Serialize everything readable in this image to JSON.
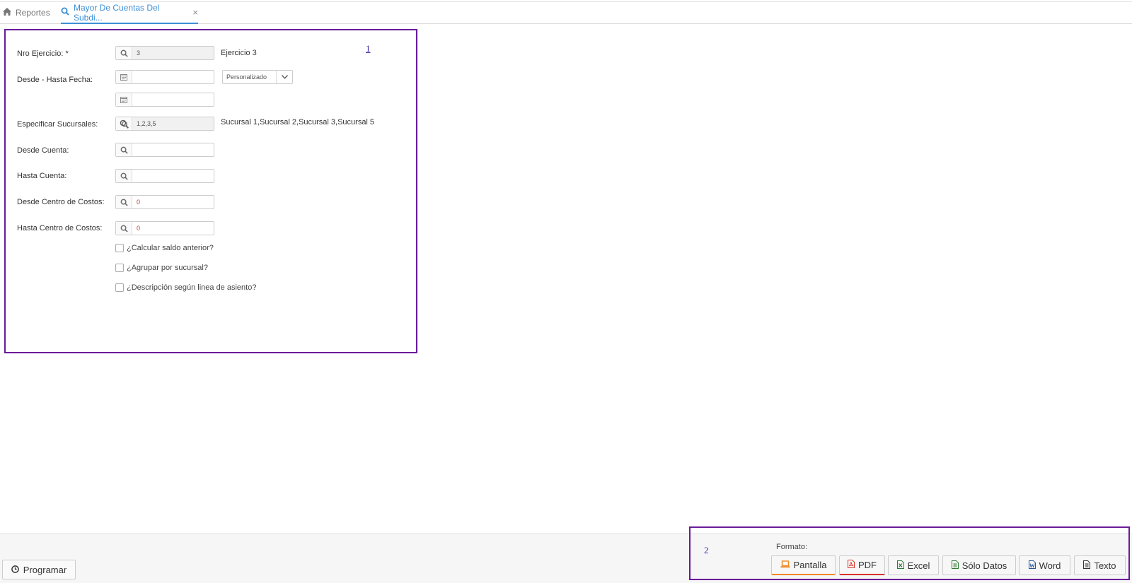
{
  "tabs": {
    "reportes_label": "Reportes",
    "active_label": "Mayor De Cuentas Del Subdi...",
    "close_glyph": "×"
  },
  "annotations": {
    "panel1": "1",
    "panel2": "2"
  },
  "form": {
    "nro_ejercicio": {
      "label": "Nro Ejercicio: *",
      "value": "3",
      "description": "Ejercicio 3"
    },
    "desde_hasta_fecha": {
      "label": "Desde - Hasta Fecha:",
      "desde_value": "",
      "hasta_value": "",
      "period_option": "Personalizado"
    },
    "sucursales": {
      "label": "Especificar Sucursales:",
      "value": "1,2,3,5",
      "description": "Sucursal 1,Sucursal 2,Sucursal 3,Sucursal 5"
    },
    "desde_cuenta": {
      "label": "Desde Cuenta:",
      "value": ""
    },
    "hasta_cuenta": {
      "label": "Hasta Cuenta:",
      "value": ""
    },
    "desde_centro": {
      "label": "Desde Centro de Costos:",
      "value": "0"
    },
    "hasta_centro": {
      "label": "Hasta Centro de Costos:",
      "value": "0"
    },
    "checkboxes": [
      {
        "label": "¿Calcular saldo anterior?",
        "checked": false
      },
      {
        "label": "¿Agrupar por sucursal?",
        "checked": false
      },
      {
        "label": "¿Descripción según linea de asiento?",
        "checked": false
      }
    ]
  },
  "footer": {
    "programar_label": "Programar",
    "formato_label": "Formato:",
    "buttons": {
      "pantalla": "Pantalla",
      "pdf": "PDF",
      "excel": "Excel",
      "solo_datos": "Sólo Datos",
      "word": "Word",
      "texto": "Texto"
    }
  },
  "colors": {
    "accent_tab": "#3d8fd6",
    "annotation_border": "#6a1b9a",
    "pantalla_accent": "#f08a24",
    "pdf_accent": "#d9342b",
    "excel_green": "#2e7d32",
    "word_blue": "#2b5797"
  },
  "icons": [
    "home-icon",
    "search-icon",
    "close-icon",
    "calendar-icon",
    "multi-search-icon",
    "chevron-down-icon",
    "clock-icon",
    "laptop-icon",
    "pdf-file-icon",
    "excel-file-icon",
    "data-file-icon",
    "word-file-icon",
    "text-file-icon"
  ]
}
